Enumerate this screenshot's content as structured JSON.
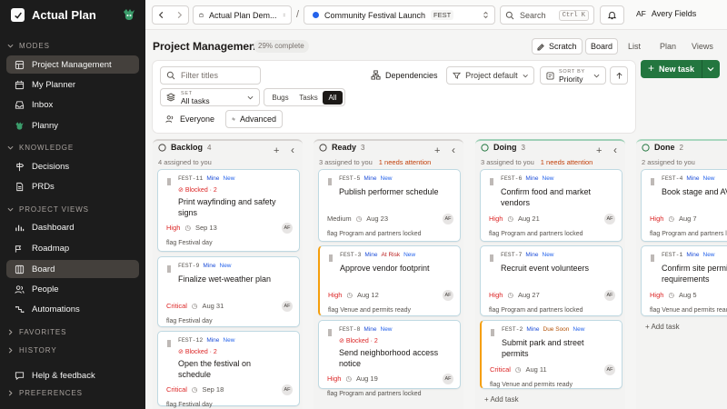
{
  "sidebar": {
    "brand": "Actual Plan",
    "sections": {
      "modes": "MODES",
      "knowledge": "KNOWLEDGE",
      "project_views": "PROJECT VIEWS",
      "favorites": "FAVORITES",
      "history": "HISTORY",
      "preferences": "PREFERENCES"
    },
    "modes": [
      {
        "label": "Project Management",
        "icon": "layout-icon"
      },
      {
        "label": "My Planner",
        "icon": "calendar-icon"
      },
      {
        "label": "Inbox",
        "icon": "inbox-icon"
      },
      {
        "label": "Planny",
        "icon": "mascot-icon"
      }
    ],
    "knowledge": [
      {
        "label": "Decisions",
        "icon": "signpost-icon"
      },
      {
        "label": "PRDs",
        "icon": "document-icon"
      }
    ],
    "project_views": [
      {
        "label": "Dashboard",
        "icon": "dashboard-icon"
      },
      {
        "label": "Roadmap",
        "icon": "roadmap-icon"
      },
      {
        "label": "Board",
        "icon": "board-icon"
      },
      {
        "label": "People",
        "icon": "people-icon"
      },
      {
        "label": "Automations",
        "icon": "automation-icon"
      }
    ],
    "help": "Help & feedback"
  },
  "topbar": {
    "workspace": "Actual Plan Dem...",
    "separator": "/",
    "project": "Community Festival Launch",
    "project_key": "FEST",
    "search_placeholder": "Search",
    "search_shortcut": "Ctrl K",
    "user_initials": "AF",
    "user_name": "Avery Fields"
  },
  "header": {
    "title": "Project Management",
    "complete": "29% complete",
    "scratch": "Scratch",
    "views": [
      "Board",
      "List",
      "Plan",
      "Views"
    ]
  },
  "filters": {
    "search_placeholder": "Filter titles",
    "dependencies": "Dependencies",
    "project_default": "Project default",
    "sort_label": "SORT BY",
    "sort_value": "Priority",
    "set_label": "SET",
    "set_value": "All tasks",
    "types": [
      "Bugs",
      "Tasks",
      "All"
    ],
    "everyone": "Everyone",
    "advanced": "Advanced",
    "new_task": "New task"
  },
  "columns": [
    {
      "name": "Backlog",
      "count": "4",
      "sub": "4 assigned to you",
      "needs": "",
      "cards": [
        {
          "id": "FEST-11",
          "badges": [
            "Mine",
            "New"
          ],
          "blocked": "Blocked · 2",
          "title": "Print wayfinding and safety signs",
          "priority": "High",
          "date": "Sep 13",
          "avatar": "AF",
          "flag": "flag Festival day"
        },
        {
          "id": "FEST-9",
          "badges": [
            "Mine",
            "New"
          ],
          "blocked": "",
          "title": "Finalize wet-weather plan",
          "priority": "Critical",
          "date": "Aug 31",
          "avatar": "AF",
          "flag": "flag Festival day"
        },
        {
          "id": "FEST-12",
          "badges": [
            "Mine",
            "New"
          ],
          "blocked": "Blocked · 2",
          "title": "Open the festival on schedule",
          "priority": "Critical",
          "date": "Sep 18",
          "avatar": "AF",
          "flag": "flag Festival day"
        }
      ]
    },
    {
      "name": "Ready",
      "count": "3",
      "sub": "3 assigned to you",
      "needs": "1 needs attention",
      "cards": [
        {
          "id": "FEST-5",
          "badges": [
            "Mine",
            "New"
          ],
          "blocked": "",
          "title": "Publish performer schedule",
          "priority": "Medium",
          "date": "Aug 23",
          "avatar": "AF",
          "flag": "flag Program and partners locked"
        },
        {
          "id": "FEST-3",
          "badges": [
            "Mine",
            "At Risk",
            "New"
          ],
          "blocked": "",
          "title": "Approve vendor footprint",
          "priority": "High",
          "date": "Aug 12",
          "avatar": "AF",
          "flag": "flag Venue and permits ready"
        },
        {
          "id": "FEST-8",
          "badges": [
            "Mine",
            "New"
          ],
          "blocked": "Blocked · 2",
          "title": "Send neighborhood access notice",
          "priority": "High",
          "date": "Aug 19",
          "avatar": "AF",
          "flag": "flag Program and partners locked"
        }
      ]
    },
    {
      "name": "Doing",
      "count": "3",
      "sub": "3 assigned to you",
      "needs": "1 needs attention",
      "cards": [
        {
          "id": "FEST-6",
          "badges": [
            "Mine",
            "New"
          ],
          "blocked": "",
          "title": "Confirm food and market vendors",
          "priority": "High",
          "date": "Aug 21",
          "avatar": "AF",
          "flag": "flag Program and partners locked"
        },
        {
          "id": "FEST-7",
          "badges": [
            "Mine",
            "New"
          ],
          "blocked": "",
          "title": "Recruit event volunteers",
          "priority": "High",
          "date": "Aug 27",
          "avatar": "AF",
          "flag": "flag Program and partners locked"
        },
        {
          "id": "FEST-2",
          "badges": [
            "Mine",
            "Due Soon",
            "New"
          ],
          "blocked": "",
          "title": "Submit park and street permits",
          "priority": "Critical",
          "date": "Aug 11",
          "avatar": "AF",
          "flag": "flag Venue and permits ready"
        }
      ],
      "add_task": "Add task"
    },
    {
      "name": "Done",
      "count": "2",
      "sub": "2 assigned to you",
      "needs": "",
      "cards": [
        {
          "id": "FEST-4",
          "badges": [
            "Mine",
            "New"
          ],
          "blocked": "",
          "title": "Book stage and AV supplier",
          "priority": "High",
          "date": "Aug 7",
          "avatar": "AF",
          "flag": "flag Program and partners locked"
        },
        {
          "id": "FEST-1",
          "badges": [
            "Mine",
            "New"
          ],
          "blocked": "",
          "title": "Confirm site permit requirements",
          "priority": "High",
          "date": "Aug 5",
          "avatar": "AF",
          "flag": "flag Venue and permits ready"
        }
      ],
      "add_task": "Add task"
    }
  ],
  "colors": {
    "sidebar": "#1c1c1c",
    "accent": "#23763f",
    "blocked": "#dc2626",
    "needs": "#c2410c",
    "card_border": "#bfd9e2"
  }
}
